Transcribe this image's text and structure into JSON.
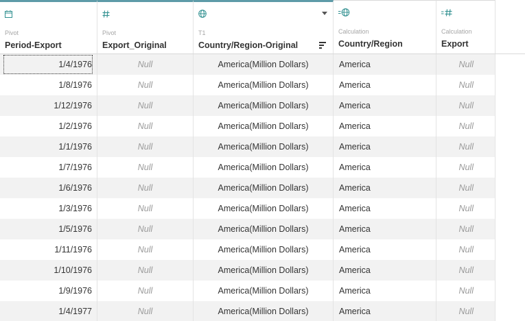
{
  "columns": [
    {
      "icon": "calendar-icon",
      "kind": "Pivot",
      "name": "Period-Export"
    },
    {
      "icon": "number-icon",
      "kind": "Pivot",
      "name": "Export_Original"
    },
    {
      "icon": "globe-icon",
      "kind": "T1",
      "name": "Country/Region-Original"
    },
    {
      "icon": "calculated-globe-icon",
      "kind": "Calculation",
      "name": "Country/Region"
    },
    {
      "icon": "calculated-number-icon",
      "kind": "Calculation",
      "name": "Export"
    }
  ],
  "rows": [
    {
      "period": "1/4/1976",
      "export_original": "Null",
      "country_original": "America(Million Dollars)",
      "country": "America",
      "export": "Null"
    },
    {
      "period": "1/8/1976",
      "export_original": "Null",
      "country_original": "America(Million Dollars)",
      "country": "America",
      "export": "Null"
    },
    {
      "period": "1/12/1976",
      "export_original": "Null",
      "country_original": "America(Million Dollars)",
      "country": "America",
      "export": "Null"
    },
    {
      "period": "1/2/1976",
      "export_original": "Null",
      "country_original": "America(Million Dollars)",
      "country": "America",
      "export": "Null"
    },
    {
      "period": "1/1/1976",
      "export_original": "Null",
      "country_original": "America(Million Dollars)",
      "country": "America",
      "export": "Null"
    },
    {
      "period": "1/7/1976",
      "export_original": "Null",
      "country_original": "America(Million Dollars)",
      "country": "America",
      "export": "Null"
    },
    {
      "period": "1/6/1976",
      "export_original": "Null",
      "country_original": "America(Million Dollars)",
      "country": "America",
      "export": "Null"
    },
    {
      "period": "1/3/1976",
      "export_original": "Null",
      "country_original": "America(Million Dollars)",
      "country": "America",
      "export": "Null"
    },
    {
      "period": "1/5/1976",
      "export_original": "Null",
      "country_original": "America(Million Dollars)",
      "country": "America",
      "export": "Null"
    },
    {
      "period": "1/11/1976",
      "export_original": "Null",
      "country_original": "America(Million Dollars)",
      "country": "America",
      "export": "Null"
    },
    {
      "period": "1/10/1976",
      "export_original": "Null",
      "country_original": "America(Million Dollars)",
      "country": "America",
      "export": "Null"
    },
    {
      "period": "1/9/1976",
      "export_original": "Null",
      "country_original": "America(Million Dollars)",
      "country": "America",
      "export": "Null"
    },
    {
      "period": "1/4/1977",
      "export_original": "Null",
      "country_original": "America(Million Dollars)",
      "country": "America",
      "export": "Null"
    }
  ],
  "colors": {
    "accent_teal": "#5e9ba8",
    "icon_teal": "#2f8f8f",
    "row_stripe": "#f2f2f2",
    "null_text": "#9a9a9a"
  }
}
